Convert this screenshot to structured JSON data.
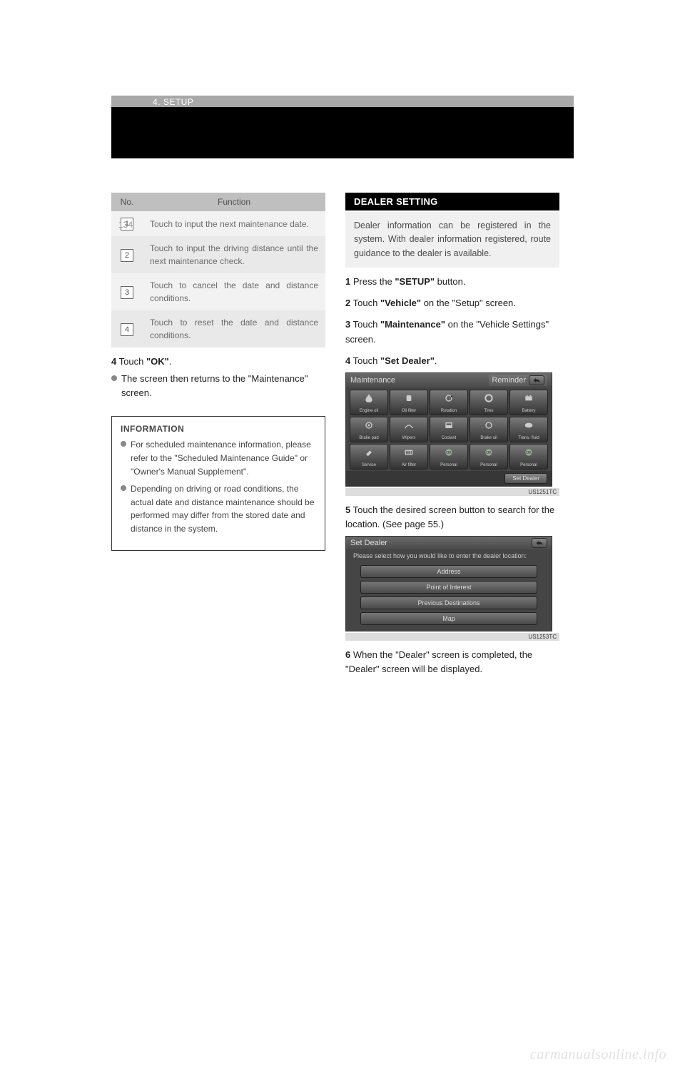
{
  "page": {
    "number": "134",
    "section_label": "4. SETUP"
  },
  "left": {
    "table": {
      "head_no": "No.",
      "head_fn": "Function",
      "rows": [
        {
          "num": "1",
          "text": "Touch to input the next maintenance date."
        },
        {
          "num": "2",
          "text": "Touch to input the driving distance until the next maintenance check."
        },
        {
          "num": "3",
          "text": "Touch to cancel the date and distance conditions."
        },
        {
          "num": "4",
          "text": "Touch to reset the date and distance conditions."
        }
      ]
    },
    "step4_num": "4",
    "step4_text_a": "Touch ",
    "step4_text_bold": "\"OK\"",
    "step4_text_b": ".",
    "step4_sub": "The screen then returns to the \"Maintenance\" screen.",
    "info_title": "INFORMATION",
    "info_items": [
      "For scheduled maintenance information, please refer to the \"Scheduled Maintenance Guide\" or \"Owner's Manual Supplement\".",
      "Depending on driving or road conditions, the actual date and distance maintenance should be performed may differ from the stored date and distance in the system."
    ]
  },
  "right": {
    "section_title": "DEALER SETTING",
    "intro": "Dealer information can be registered in the system. With dealer information registered, route guidance to the dealer is available.",
    "step1_num": "1",
    "step1_a": "Press the ",
    "step1_bold": "\"SETUP\"",
    "step1_b": " button.",
    "step2_num": "2",
    "step2_a": "Touch ",
    "step2_bold": "\"Vehicle\"",
    "step2_b": " on the \"Setup\" screen.",
    "step3_num": "3",
    "step3_a": "Touch ",
    "step3_bold": "\"Maintenance\"",
    "step3_b": " on the \"Vehicle Settings\" screen.",
    "step4_num": "4",
    "step4_a": "Touch ",
    "step4_bold": "\"Set Dealer\"",
    "step4_b": ".",
    "maintenance_screen": {
      "title": "Maintenance",
      "reminder_label": "Reminder",
      "code": "US1251TC",
      "set_dealer": "Set Dealer",
      "tiles": [
        "Engine oil",
        "Oil filter",
        "Rotation",
        "Tires",
        "Battery",
        "Brake pad",
        "Wipers",
        "Coolant",
        "Brake oil",
        "Trans. fluid",
        "Service",
        "Air filter",
        "Personal",
        "Personal",
        "Personal"
      ]
    },
    "step5_num": "5",
    "step5_a": "Touch the desired screen button to search for the location. (See page 55.)",
    "set_dealer_screen": {
      "title": "Set Dealer",
      "prompt": "Please select how you would like to enter the dealer location:",
      "code": "US1253TC",
      "options": [
        "Address",
        "Point of Interest",
        "Previous Destinations",
        "Map"
      ]
    },
    "step6_num": "6",
    "step6_text": "When the \"Dealer\" screen is completed, the \"Dealer\" screen will be displayed."
  },
  "footer": {
    "watermark": "carmanualsonline.info"
  }
}
